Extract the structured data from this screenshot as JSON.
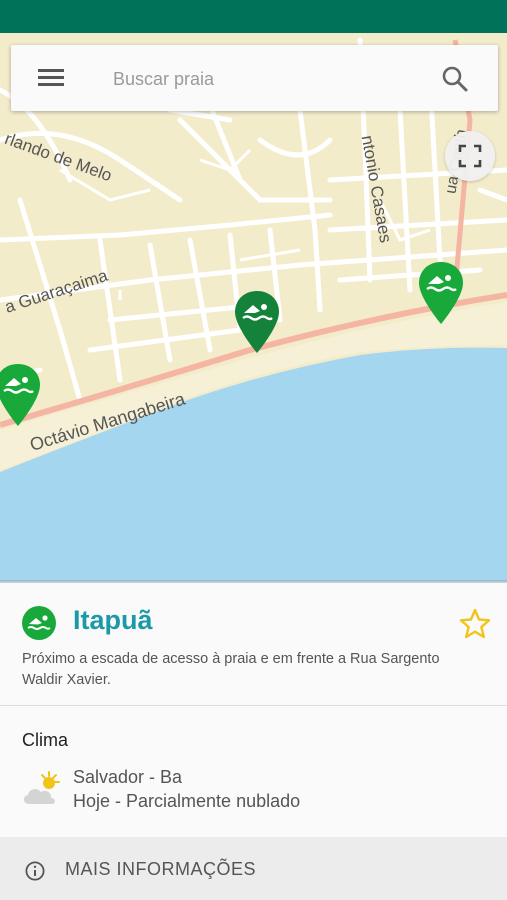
{
  "search": {
    "placeholder": "Buscar praia"
  },
  "map": {
    "street_labels": [
      "rlando de Melo",
      "a Guaraçaima",
      "ntonio Casaes",
      "Octávio Mangabeira",
      "ua Caeth"
    ],
    "colors": {
      "land": "#f3eccb",
      "water": "#a4d6f0",
      "sand": "#f6f0d7",
      "road_main": "#f4b5a3",
      "road_minor": "#ffffff"
    }
  },
  "detail": {
    "title": "Itapuã",
    "description": "Próximo a escada de acesso à praia e em frente a Rua Sargento Waldir Xavier.",
    "favorite_icon": "star-outline-icon"
  },
  "weather": {
    "heading": "Clima",
    "city": "Salvador - Ba",
    "forecast": "Hoje - Parcialmente nublado",
    "icon": "partly-cloudy-icon"
  },
  "more_info": {
    "label": "MAIS INFORMAÇÕES",
    "icon": "info-icon"
  },
  "colors": {
    "status_bar": "#00725a",
    "accent": "#1a9aa8",
    "pin_green": "#18a93a",
    "pin_dark": "#14823a",
    "star": "#f0c419"
  }
}
